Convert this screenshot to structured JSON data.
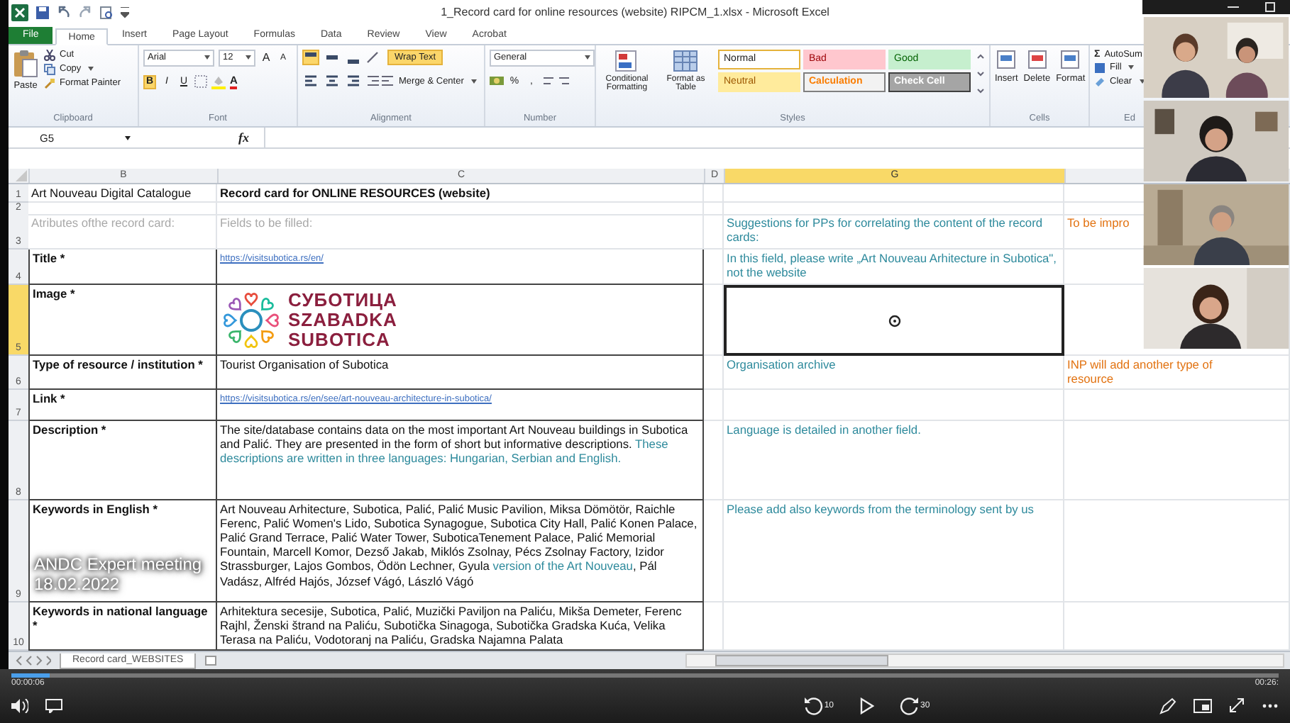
{
  "window": {
    "title": "1_Record card for online resources (website) RIPCM_1.xlsx  -  Microsoft Excel"
  },
  "ribbon_tabs": [
    {
      "label": "File",
      "kind": "file",
      "selected": false
    },
    {
      "label": "Home",
      "kind": "tab",
      "selected": true
    },
    {
      "label": "Insert",
      "kind": "tab",
      "selected": false
    },
    {
      "label": "Page Layout",
      "kind": "tab",
      "selected": false
    },
    {
      "label": "Formulas",
      "kind": "tab",
      "selected": false
    },
    {
      "label": "Data",
      "kind": "tab",
      "selected": false
    },
    {
      "label": "Review",
      "kind": "tab",
      "selected": false
    },
    {
      "label": "View",
      "kind": "tab",
      "selected": false
    },
    {
      "label": "Acrobat",
      "kind": "tab",
      "selected": false
    }
  ],
  "ribbon": {
    "clipboard": {
      "label": "Clipboard",
      "paste": "Paste",
      "cut": "Cut",
      "copy": "Copy",
      "format_painter": "Format Painter"
    },
    "font": {
      "label": "Font",
      "name": "Arial",
      "size": "12",
      "grow": "A",
      "shrink": "A",
      "font_color": "A",
      "buttons": [
        {
          "label": "B",
          "kind": "bold",
          "selected": true
        },
        {
          "label": "I",
          "kind": "italic",
          "selected": false
        },
        {
          "label": "U",
          "kind": "underline",
          "selected": false
        }
      ]
    },
    "alignment": {
      "label": "Alignment",
      "wrap_text": {
        "label": "Wrap Text",
        "selected": true
      },
      "merge": "Merge & Center",
      "vertical": [
        {
          "kind": "top",
          "selected": true
        },
        {
          "kind": "middle",
          "selected": false
        },
        {
          "kind": "bottom",
          "selected": false
        }
      ],
      "horizontal": [
        {
          "kind": "left",
          "selected": false
        },
        {
          "kind": "center",
          "selected": false
        },
        {
          "kind": "right",
          "selected": false
        }
      ]
    },
    "number": {
      "label": "Number",
      "format": "General",
      "percent": "%",
      "comma": ","
    },
    "styles": {
      "label": "Styles",
      "conditional": "Conditional Formatting",
      "format_table": "Format as Table",
      "cell_styles": [
        {
          "label": "Normal",
          "kind": "normal"
        },
        {
          "label": "Bad",
          "kind": "bad"
        },
        {
          "label": "Good",
          "kind": "good"
        },
        {
          "label": "Neutral",
          "kind": "neutral"
        },
        {
          "label": "Calculation",
          "kind": "calculation"
        },
        {
          "label": "Check Cell",
          "kind": "check"
        }
      ]
    },
    "cells": {
      "label": "Cells",
      "buttons": [
        "Insert",
        "Delete",
        "Format"
      ]
    },
    "editing": {
      "label": "Ed",
      "sigma": "Σ",
      "autosum": "AutoSum",
      "fill": "Fill",
      "clear": "Clear"
    }
  },
  "formula_bar": {
    "name_box": "G5",
    "fx": "fx"
  },
  "sheet": {
    "columns": [
      {
        "label": "B",
        "selected": false
      },
      {
        "label": "C",
        "selected": false
      },
      {
        "label": "D",
        "selected": false
      },
      {
        "label": "G",
        "selected": true
      }
    ],
    "rows": [
      {
        "number": "1",
        "kind": "heading",
        "selected": false,
        "b": {
          "kind": "plain",
          "text": "Art Nouveau Digital Catalogue"
        },
        "c": {
          "kind": "bold",
          "text": "Record card for ONLINE RESOURCES (website)"
        }
      },
      {
        "number": "2",
        "kind": "heading",
        "selected": false
      },
      {
        "number": "3",
        "kind": "heading",
        "selected": false,
        "b": {
          "kind": "muted",
          "text": "Atributes ofthe record card:"
        },
        "c": {
          "kind": "muted",
          "text": "Fields to be filled:"
        },
        "g": {
          "kind": "note",
          "text": "Suggestions for PPs for correlating the content of the record cards:"
        },
        "h": {
          "kind": "warning",
          "text": "To be impro"
        }
      },
      {
        "number": "4",
        "kind": "field",
        "selected": false,
        "b": {
          "kind": "bold",
          "text": "Title *"
        },
        "c": {
          "kind": "link",
          "text": "https://visitsubotica.rs/en/"
        },
        "g": {
          "kind": "note",
          "text": "In this field, please write „Art Nouveau Arhitecture in Subotica\", not the website"
        }
      },
      {
        "number": "5",
        "kind": "field",
        "selected": true,
        "b": {
          "kind": "bold",
          "text": "Image *"
        },
        "c": {
          "kind": "logo",
          "lines": [
            "СУБОТИЦА",
            "SZABADKA",
            "SUBOTICA"
          ]
        },
        "g": {
          "active": true
        }
      },
      {
        "number": "6",
        "kind": "field",
        "selected": false,
        "b": {
          "kind": "bold",
          "text": "Type of resource / institution *"
        },
        "c": {
          "kind": "plain",
          "text": "Tourist Organisation of Subotica"
        },
        "g": {
          "kind": "note",
          "text": "Organisation archive"
        },
        "h": {
          "kind": "warning",
          "text": "INP will add another type of resource"
        }
      },
      {
        "number": "7",
        "kind": "field",
        "selected": false,
        "b": {
          "kind": "bold",
          "text": "Link *"
        },
        "c": {
          "kind": "link",
          "text": "https://visitsubotica.rs/en/see/art-nouveau-architecture-in-subotica/"
        }
      },
      {
        "number": "8",
        "kind": "field",
        "selected": false,
        "b": {
          "kind": "bold",
          "text": "Description *"
        },
        "c": {
          "kind": "mixed",
          "segments": [
            {
              "kind": "plain",
              "text": "The site/database contains data on the most important Art Nouveau buildings in Subotica and Palić. They are presented in the form of short but informative descriptions. "
            },
            {
              "kind": "note",
              "text": "These descriptions are written in three languages: Hungarian, Serbian and English."
            }
          ]
        },
        "g": {
          "kind": "note",
          "text": "Language is detailed in another field."
        }
      },
      {
        "number": "9",
        "kind": "field",
        "selected": false,
        "b": {
          "kind": "bold",
          "text": "Keywords in English *"
        },
        "c": {
          "kind": "mixed",
          "segments": [
            {
              "kind": "plain",
              "text": "Art Nouveau Arhitecture, Subotica, Palić, Palić Music Pavilion, Miksa Dömötör, Raichle Ferenc, Palić Women's Lido, Subotica Synagogue, Subotica City Hall, Palić Konen Palace, Palić Grand Terrace, Palić Water Tower, SuboticaTenement Palace, Palić Memorial Fountain, Marcell Komor, Dezső Jakab, Miklós Zsolnay, Pécs Zsolnay Factory, Izidor Strassburger, Lajos Gombos, Ödön Lechner, Gyula "
            },
            {
              "kind": "note",
              "text": "version of the Art Nouveau"
            },
            {
              "kind": "plain",
              "text": ", Pál Vadász, Alfréd Hajós, József Vágó, László Vágó"
            }
          ]
        },
        "g": {
          "kind": "note",
          "text": "Please add also keywords from the terminology sent by us"
        }
      },
      {
        "number": "10",
        "kind": "field",
        "selected": false,
        "b": {
          "kind": "bold",
          "text": "Keywords in national language *"
        },
        "c": {
          "kind": "plain",
          "text": "Arhitektura secesije, Subotica, Palić, Muzički Paviljon na Paliću, Mikša Demeter, Ferenc Rajhl, Ženski štrand na Paliću, Subotička Sinagoga, Subotička Gradska Kuća, Velika Terasa na Paliću, Vodotoranj na Paliću, Gradska Najamna Palata"
        }
      }
    ]
  },
  "sheet_tabs": [
    {
      "label": "Record card_WEBSITES",
      "selected": true
    }
  ],
  "video": {
    "title": "ANDC Expert meeting 18.02.2022",
    "elapsed": "00:00:06",
    "total": "00:26:",
    "level": 0.03,
    "rewind": "10",
    "forward": "30"
  }
}
